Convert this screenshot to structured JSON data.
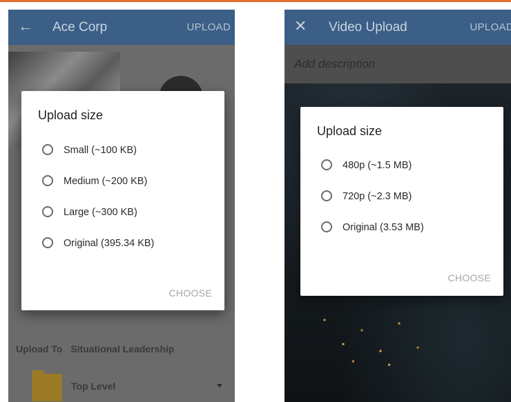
{
  "left_screen": {
    "appbar": {
      "nav_icon": "back-arrow-icon",
      "title": "Ace Corp",
      "action": "UPLOAD"
    },
    "upload_to": {
      "label": "Upload To",
      "value": "Situational Leadership"
    },
    "folder": {
      "icon": "folder-icon",
      "label": "Top Level"
    },
    "dialog": {
      "title": "Upload size",
      "options": [
        {
          "label": "Small (~100 KB)",
          "selected": false
        },
        {
          "label": "Medium (~200 KB)",
          "selected": false
        },
        {
          "label": "Large (~300 KB)",
          "selected": false
        },
        {
          "label": "Original (395.34 KB)",
          "selected": false
        }
      ],
      "choose_label": "CHOOSE"
    }
  },
  "right_screen": {
    "appbar": {
      "nav_icon": "close-icon",
      "title": "Video Upload",
      "action": "UPLOAD"
    },
    "description_placeholder": "Add description",
    "dialog": {
      "title": "Upload size",
      "options": [
        {
          "label": "480p (~1.5 MB)",
          "selected": false
        },
        {
          "label": "720p (~2.3 MB)",
          "selected": false
        },
        {
          "label": "Original (3.53 MB)",
          "selected": false
        }
      ],
      "choose_label": "CHOOSE"
    }
  },
  "colors": {
    "accent_rule": "#e2702e",
    "appbar": "#3b5f86",
    "folder": "#e0b33a"
  }
}
